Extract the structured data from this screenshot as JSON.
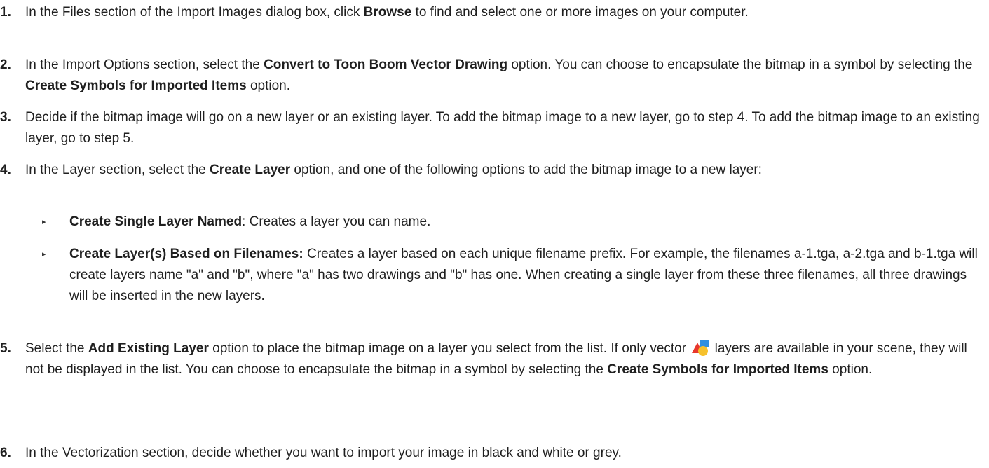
{
  "steps": [
    {
      "num": "1.",
      "t1": "In the Files section of the Import Images dialog box, click ",
      "b1": "Browse",
      "t2": " to find and select one or more images on your computer."
    },
    {
      "num": "2.",
      "t1": "In the Import Options section, select the ",
      "b1": "Convert to Toon Boom Vector Drawing",
      "t2": " option. You can choose to encapsulate the bitmap in a symbol by selecting the ",
      "b2": "Create Symbols for Imported Items",
      "t3": " option."
    },
    {
      "num": "3.",
      "t1": "Decide if the bitmap image will go on a new layer or an existing layer. To add the bitmap image to a new layer, go to step 4. To add the bitmap image to an existing layer, go to step 5."
    },
    {
      "num": "4.",
      "t1": "In the Layer section, select the ",
      "b1": "Create Layer",
      "t2": " option, and one of the following options to add the bitmap image to a new layer:",
      "bullets": [
        {
          "b": "Create Single Layer Named",
          "t": ": Creates a layer you can name."
        },
        {
          "b": "Create Layer(s) Based on Filenames:",
          "t": " Creates a layer based on each unique filename prefix. For example, the filenames a-1.tga, a-2.tga and b-1.tga will create layers name \"a\" and \"b\", where \"a\" has two drawings and \"b\" has one. When creating a single layer from these three filenames, all three drawings will be inserted in the new layers."
        }
      ]
    },
    {
      "num": "5.",
      "t1": "Select the ",
      "b1": "Add Existing Layer",
      "t2": " option to place the bitmap image on a layer you select from the list. If only vector ",
      "icon": "vector-layer-icon",
      "t3": " layers are available in your scene, they will not be displayed in the list. You can choose to encapsulate the bitmap in a symbol by selecting the ",
      "b2": "Create Symbols for Imported Items",
      "t4": " option."
    },
    {
      "num": "6.",
      "t1": "In the Vectorization section, decide whether you want to import your image in black and white or grey."
    }
  ],
  "bullet_glyph": "▸",
  "colors": {
    "text": "#1f1f1f",
    "icon_triangle": "#e8372c",
    "icon_square": "#2f8fe0",
    "icon_circle": "#f6c12c"
  }
}
